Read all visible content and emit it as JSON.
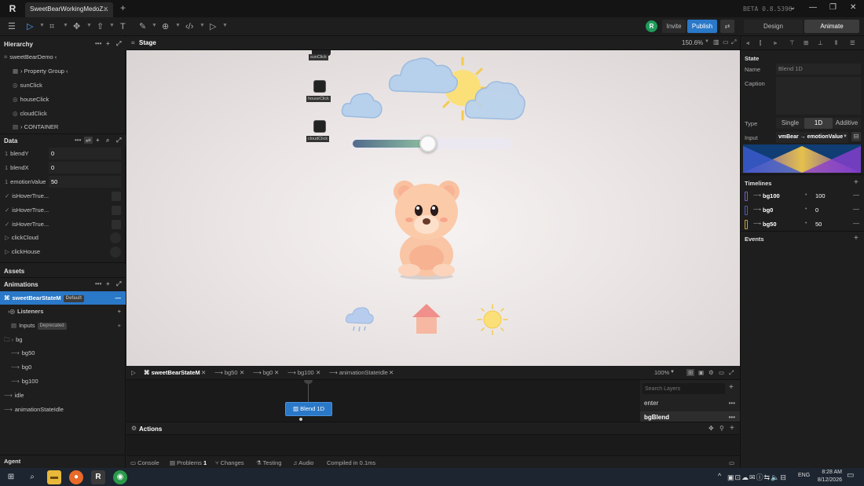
{
  "window": {
    "tab_title": "SweetBearWorkingMedoZ...",
    "version": "BETA 0.8.5396",
    "app_logo": "R"
  },
  "toolbar": {
    "avatar_initial": "R",
    "invite": "Invite",
    "publish": "Publish",
    "design_tab": "Design",
    "animate_tab": "Animate"
  },
  "hierarchy": {
    "title": "Hierarchy",
    "items": [
      {
        "label": "sweetBearDemo ‹",
        "icon": "artboard-icon"
      },
      {
        "label": "› Property Group ‹",
        "icon": "group-icon"
      },
      {
        "label": "sunClick",
        "icon": "component-icon"
      },
      {
        "label": "houseClick",
        "icon": "component-icon"
      },
      {
        "label": "cloudClick",
        "icon": "component-icon"
      },
      {
        "label": "› CONTAINER",
        "icon": "container-icon"
      }
    ]
  },
  "data_panel": {
    "title": "Data",
    "rows": [
      {
        "type": "1",
        "name": "blendY",
        "value": "0"
      },
      {
        "type": "1",
        "name": "blendX",
        "value": "0"
      },
      {
        "type": "1",
        "name": "emotionValue",
        "value": "50"
      },
      {
        "type": "✓",
        "name": "isHoverTrue..."
      },
      {
        "type": "✓",
        "name": "isHoverTrue..."
      },
      {
        "type": "✓",
        "name": "isHoverTrue..."
      },
      {
        "type": "▷",
        "name": "clickCloud"
      },
      {
        "type": "▷",
        "name": "clickHouse"
      }
    ]
  },
  "assets": {
    "title": "Assets"
  },
  "animations": {
    "title": "Animations",
    "state_machine": "sweetBearStateM",
    "default_badge": "Default",
    "listeners": "Listeners",
    "inputs": "Inputs",
    "deprecated_badge": "Deprecated",
    "folder": "bg",
    "children": [
      "bg50",
      "bg0",
      "bg100"
    ],
    "others": [
      "idle",
      "animationStateIdle"
    ]
  },
  "agent": {
    "label": "Agent"
  },
  "stage": {
    "title": "Stage",
    "zoom": "150.6%",
    "buttons": [
      {
        "label": "sunClick"
      },
      {
        "label": "houseClick"
      },
      {
        "label": "cloudClick"
      }
    ],
    "slider_value": 50
  },
  "timeline_tabs": [
    "sweetBearStateM",
    "bg50",
    "bg0",
    "bg100",
    "animationStateIdle"
  ],
  "timeline_zoom": "100%",
  "graph": {
    "node": "Blend 1D"
  },
  "layers": {
    "search_placeholder": "Search Layers",
    "items": [
      "enter",
      "bgBlend"
    ]
  },
  "actions": {
    "title": "Actions"
  },
  "status": {
    "console": "Console",
    "problems": "Problems",
    "problems_count": "1",
    "changes": "Changes",
    "testing": "Testing",
    "audio": "Audio",
    "compiled": "Compiled in 0.1ms"
  },
  "inspector": {
    "state_title": "State",
    "name_label": "Name",
    "name_value": "Blend 1D",
    "caption_label": "Caption",
    "type_label": "Type",
    "type_options": [
      "Single",
      "1D",
      "Additive"
    ],
    "type_selected": "1D",
    "input_label": "Input",
    "input_value": "vmBear → emotionValue",
    "timelines_title": "Timelines",
    "timelines": [
      {
        "name": "bg100",
        "value": "100",
        "color": "#7a5cc0"
      },
      {
        "name": "bg0",
        "value": "0",
        "color": "#4f5bb0"
      },
      {
        "name": "bg50",
        "value": "50",
        "color": "#c8a23a"
      }
    ],
    "events_title": "Events"
  },
  "taskbar": {
    "time": "8:28 AM",
    "date": "8/12/2026",
    "lang": "ENG"
  },
  "colors": {
    "accent": "#2a78c8",
    "bg": "#1e1e1e"
  }
}
